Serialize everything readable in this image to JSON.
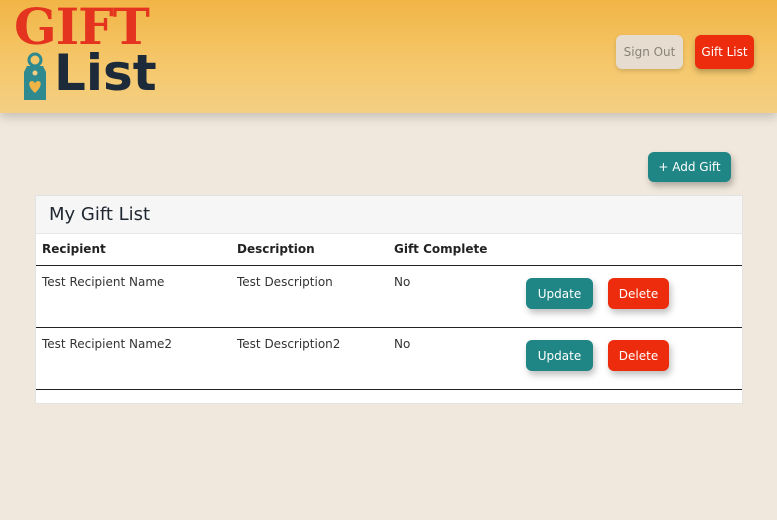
{
  "header": {
    "logo": {
      "top_word": "GIFT",
      "bottom_word": "List"
    },
    "sign_out_label": "Sign Out",
    "gift_list_label": "Gift List"
  },
  "toolbar": {
    "add_gift_label": "+ Add Gift"
  },
  "card": {
    "title": "My Gift List",
    "columns": [
      "Recipient",
      "Description",
      "Gift Complete"
    ],
    "rows": [
      {
        "recipient": "Test Recipient Name",
        "description": "Test Description",
        "complete": "No",
        "update_label": "Update",
        "delete_label": "Delete"
      },
      {
        "recipient": "Test Recipient Name2",
        "description": "Test Description2",
        "complete": "No",
        "update_label": "Update",
        "delete_label": "Delete"
      }
    ]
  },
  "colors": {
    "accent_teal": "#1f8585",
    "accent_red": "#ec2c0c",
    "header_gold": "#f1b546",
    "page_bg": "#f0e8dc"
  }
}
